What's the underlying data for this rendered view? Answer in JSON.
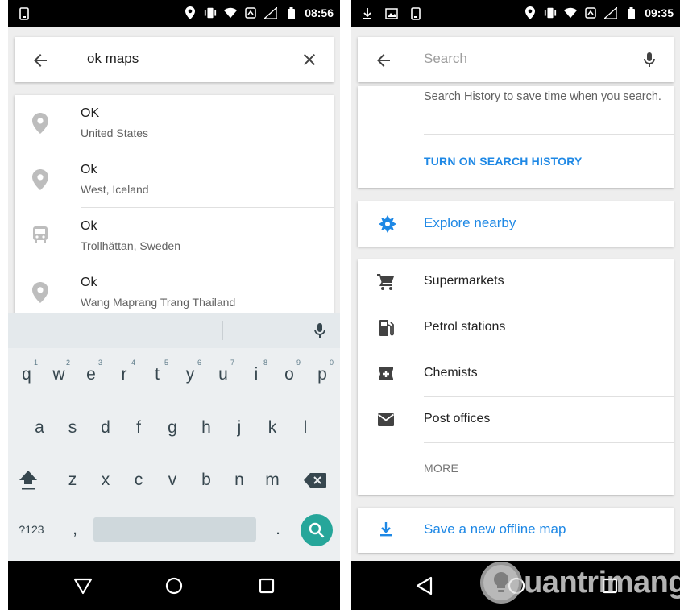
{
  "left_screen": {
    "status_bar": {
      "time": "08:56"
    },
    "search": {
      "query": "ok maps"
    },
    "results": [
      {
        "title": "OK",
        "subtitle": "United States",
        "icon": "place-pin-icon"
      },
      {
        "title": "Ok",
        "subtitle": "West, Iceland",
        "icon": "place-pin-icon"
      },
      {
        "title": "Ok",
        "subtitle": "Trollhättan, Sweden",
        "icon": "bus-stop-icon"
      },
      {
        "title": "Ok",
        "subtitle": "Wang Maprang Trang Thailand",
        "icon": "place-pin-icon"
      }
    ],
    "keyboard": {
      "row1": [
        {
          "key": "q",
          "hint": "1"
        },
        {
          "key": "w",
          "hint": "2"
        },
        {
          "key": "e",
          "hint": "3"
        },
        {
          "key": "r",
          "hint": "4"
        },
        {
          "key": "t",
          "hint": "5"
        },
        {
          "key": "y",
          "hint": "6"
        },
        {
          "key": "u",
          "hint": "7"
        },
        {
          "key": "i",
          "hint": "8"
        },
        {
          "key": "o",
          "hint": "9"
        },
        {
          "key": "p",
          "hint": "0"
        }
      ],
      "row2": [
        "a",
        "s",
        "d",
        "f",
        "g",
        "h",
        "j",
        "k",
        "l"
      ],
      "row3": [
        "z",
        "x",
        "c",
        "v",
        "b",
        "n",
        "m"
      ],
      "symbols_key": "?123",
      "comma_key": ",",
      "period_key": "."
    }
  },
  "right_screen": {
    "status_bar": {
      "time": "09:35"
    },
    "search": {
      "placeholder": "Search"
    },
    "history": {
      "text": "Search History to save time when you search.",
      "button": "TURN ON SEARCH HISTORY"
    },
    "explore": {
      "label": "Explore nearby"
    },
    "categories": [
      {
        "label": "Supermarkets",
        "icon": "shopping-cart-icon"
      },
      {
        "label": "Petrol stations",
        "icon": "gas-station-icon"
      },
      {
        "label": "Chemists",
        "icon": "pharmacy-icon"
      },
      {
        "label": "Post offices",
        "icon": "mail-icon"
      }
    ],
    "more": "MORE",
    "offline": {
      "label": "Save a new offline map"
    },
    "watermark": "uantrimang"
  },
  "colors": {
    "accent_blue": "#1e88e5",
    "keyboard_search": "#26a69a",
    "status_bar": "#000000"
  }
}
